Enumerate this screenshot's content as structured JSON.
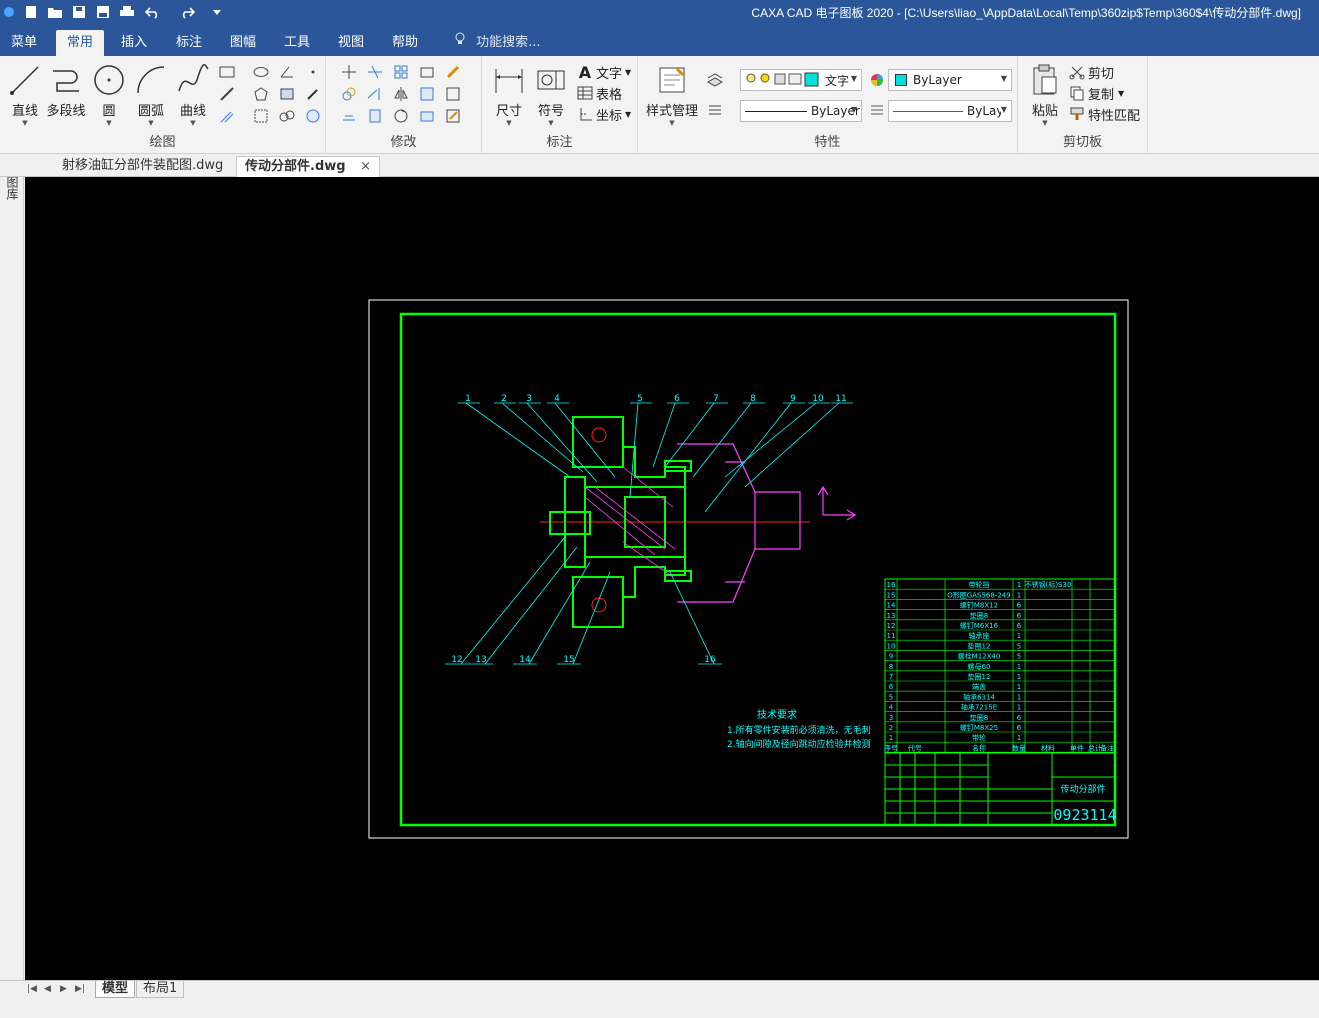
{
  "titlebar": {
    "title": "CAXA CAD 电子图板 2020 - [C:\\Users\\liao_\\AppData\\Local\\Temp\\360zip$Temp\\360$4\\传动分部件.dwg]"
  },
  "menu_tabs": [
    "菜单",
    "常用",
    "插入",
    "标注",
    "图幅",
    "工具",
    "视图",
    "帮助"
  ],
  "active_tab": "常用",
  "search_placeholder": "功能搜索...",
  "ribbon": {
    "draw": {
      "label": "绘图",
      "line": "直线",
      "polyline": "多段线",
      "circle": "圆",
      "arc": "圆弧",
      "curve": "曲线"
    },
    "modify": {
      "label": "修改"
    },
    "annotate": {
      "label": "标注",
      "dimension": "尺寸",
      "symbol": "符号",
      "text": "文字",
      "table": "表格",
      "coordinate": "坐标"
    },
    "properties": {
      "label": "特性",
      "style_manager": "样式管理",
      "text_style": "文字",
      "layer": "ByLayer",
      "color": "ByLayer",
      "linetype": "ByLayer"
    },
    "clipboard": {
      "label": "剪切板",
      "paste": "粘贴",
      "cut": "剪切",
      "copy": "复制",
      "match": "特性匹配"
    }
  },
  "doc_tabs": [
    {
      "name": "射移油缸分部件装配图.dwg",
      "active": false
    },
    {
      "name": "传动分部件.dwg",
      "active": true
    }
  ],
  "left_strip": "图库",
  "drawing": {
    "balloons_top": [
      "1",
      "2",
      "3",
      "4",
      "5",
      "6",
      "7",
      "8",
      "9",
      "10",
      "11"
    ],
    "balloons_bottom": [
      "12",
      "13",
      "14",
      "15",
      "16"
    ],
    "tech_title": "技术要求",
    "tech_notes": [
      "1.所有零件安装前必须清洗，无毛刺",
      "2.轴向间隙及径向跳动应检验并检测"
    ],
    "bom_rows": [
      {
        "no": "16",
        "name": "带轮挡",
        "qty": "1",
        "mat": "不锈钢(标)S30"
      },
      {
        "no": "15",
        "name": "O形圈GAS568-249",
        "qty": "1",
        "mat": ""
      },
      {
        "no": "14",
        "name": "螺钉M8X12",
        "qty": "6",
        "mat": ""
      },
      {
        "no": "13",
        "name": "垫圈8",
        "qty": "6",
        "mat": ""
      },
      {
        "no": "12",
        "name": "螺钉M6X16",
        "qty": "6",
        "mat": ""
      },
      {
        "no": "11",
        "name": "轴承座",
        "qty": "1",
        "mat": ""
      },
      {
        "no": "10",
        "name": "垫圈12",
        "qty": "5",
        "mat": ""
      },
      {
        "no": "9",
        "name": "螺栓M12X40",
        "qty": "5",
        "mat": ""
      },
      {
        "no": "8",
        "name": "螺母60",
        "qty": "1",
        "mat": ""
      },
      {
        "no": "7",
        "name": "垫圈12",
        "qty": "1",
        "mat": ""
      },
      {
        "no": "6",
        "name": "端盖",
        "qty": "1",
        "mat": ""
      },
      {
        "no": "5",
        "name": "轴承6314",
        "qty": "1",
        "mat": ""
      },
      {
        "no": "4",
        "name": "轴承7215E",
        "qty": "1",
        "mat": ""
      },
      {
        "no": "3",
        "name": "垫圈8",
        "qty": "6",
        "mat": ""
      },
      {
        "no": "2",
        "name": "螺钉M8X25",
        "qty": "6",
        "mat": ""
      },
      {
        "no": "1",
        "name": "带轮",
        "qty": "1",
        "mat": ""
      }
    ],
    "bom_header": [
      "序号",
      "代号",
      "名称",
      "数量",
      "材料",
      "单件",
      "总计",
      "备注"
    ],
    "part_name": "传动分部件",
    "drawing_no": "0923114"
  },
  "bottom_tabs": [
    {
      "name": "模型",
      "active": true
    },
    {
      "name": "布局1",
      "active": false
    }
  ],
  "colors": {
    "titlebar": "#2b579a",
    "frame": "#00ff00",
    "cyan": "#00ffff",
    "magenta": "#ff40ff",
    "red": "#ff2020"
  }
}
